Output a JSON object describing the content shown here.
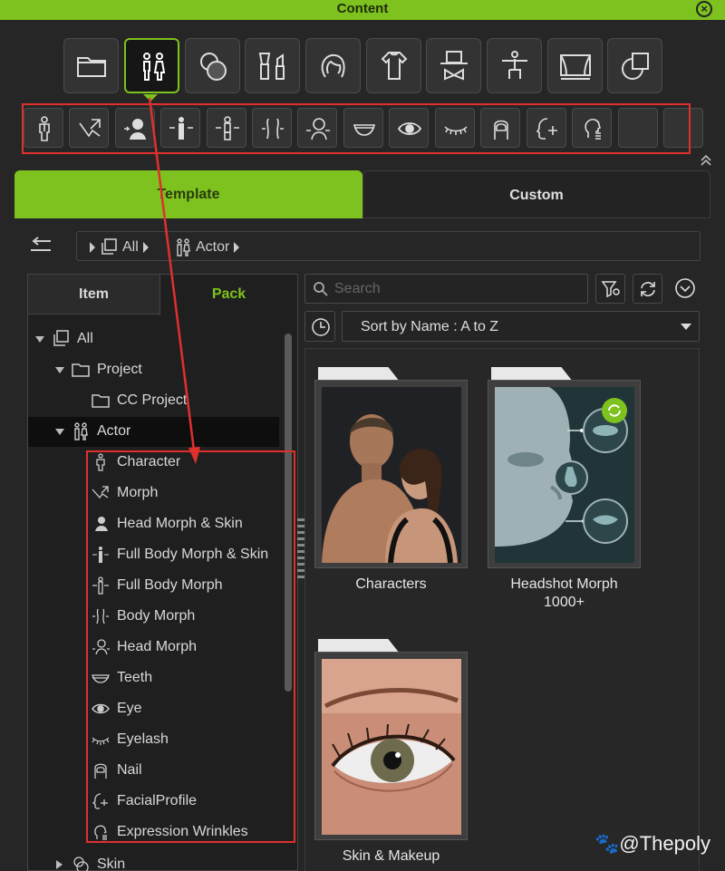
{
  "window": {
    "title": "Content"
  },
  "category_icons": [
    "folder-icon",
    "actor-icon",
    "skin-icon",
    "makeup-icon",
    "hair-icon",
    "cloth-icon",
    "accessory-icon",
    "pose-icon",
    "stage-icon",
    "misc-icon"
  ],
  "sub_icons": [
    "character-icon",
    "morph-icon",
    "head-morph-skin-icon",
    "full-body-morph-skin-icon",
    "full-body-morph-icon",
    "body-morph-icon",
    "head-morph-icon",
    "teeth-icon",
    "eye-icon",
    "eyelash-icon",
    "nail-icon",
    "facial-profile-icon",
    "expression-wrinkles-icon",
    "empty-slot",
    "empty-slot"
  ],
  "tabs": {
    "template": "Template",
    "custom": "Custom"
  },
  "breadcrumb": {
    "seg1": "All",
    "seg2": "Actor"
  },
  "subtabs": {
    "item": "Item",
    "pack": "Pack"
  },
  "tree": {
    "all": "All",
    "project": "Project",
    "cc_project": "CC Project",
    "actor": "Actor",
    "children": [
      "Character",
      "Morph",
      "Head Morph & Skin",
      "Full Body Morph & Skin",
      "Full Body Morph",
      "Body Morph",
      "Head Morph",
      "Teeth",
      "Eye",
      "Eyelash",
      "Nail",
      "FacialProfile",
      "Expression Wrinkles"
    ],
    "skin": "Skin"
  },
  "search": {
    "placeholder": "Search"
  },
  "sort": {
    "label": "Sort by Name : A to Z"
  },
  "cards": [
    {
      "caption": "Characters"
    },
    {
      "caption": "Headshot Morph\n1000+"
    },
    {
      "caption": "Skin & Makeup"
    }
  ],
  "watermark": "@Thepoly",
  "colors": {
    "accent": "#7dc21e",
    "annotation": "#e0302e",
    "background": "#262626"
  }
}
